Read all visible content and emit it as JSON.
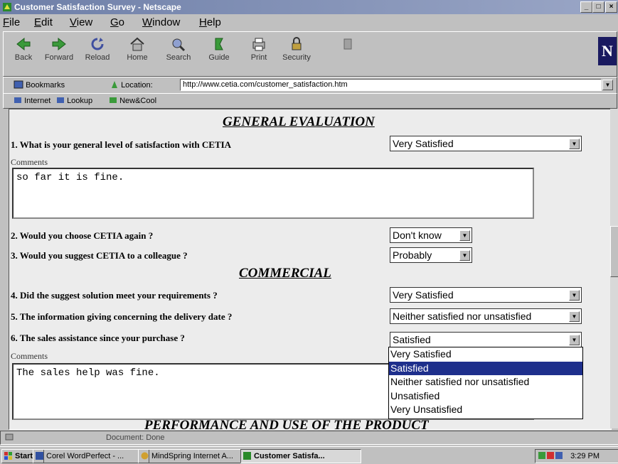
{
  "window": {
    "title": "Customer Satisfaction Survey - Netscape",
    "controls": [
      "_",
      "□",
      "×"
    ]
  },
  "menu": [
    "File",
    "Edit",
    "View",
    "Go",
    "Window",
    "Help"
  ],
  "toolbar": {
    "buttons": [
      "Back",
      "Forward",
      "Reload",
      "Home",
      "Search",
      "Guide",
      "Print",
      "Security"
    ],
    "logo": "N"
  },
  "location": {
    "bookmarks_label": "Bookmarks",
    "location_label": "Location:",
    "url": "http://www.cetia.com/customer_satisfaction.htm"
  },
  "personal_toolbar": [
    "Internet",
    "Lookup",
    "New&Cool"
  ],
  "survey": {
    "sections": {
      "general": "GENERAL EVALUATION",
      "commercial": "COMMERCIAL",
      "performance": "PERFORMANCE AND USE OF THE PRODUCT"
    },
    "comments_label": "Comments",
    "questions": [
      {
        "text": "1. What is your general level of satisfaction with CETIA",
        "answer": "Very Satisfied"
      },
      {
        "text": "2. Would you choose CETIA again ?",
        "answer": "Don't know"
      },
      {
        "text": "3. Would you suggest CETIA to a colleague ?",
        "answer": "Probably"
      },
      {
        "text": "4. Did the suggest solution meet your requirements ?",
        "answer": "Very Satisfied"
      },
      {
        "text": "5. The information giving concerning the delivery date ?",
        "answer": "Neither satisfied nor unsatisfied"
      },
      {
        "text": "6. The sales assistance since your purchase ?",
        "answer": "Satisfied"
      }
    ],
    "comment1": "so far it is fine.",
    "comment2": "The sales help was fine.",
    "dropdown_options": [
      "Very Satisfied",
      "Satisfied",
      "Neither satisfied nor unsatisfied",
      "Unsatisfied",
      "Very Unsatisfied"
    ],
    "dropdown_highlight": "Satisfied"
  },
  "status": {
    "text": "Document: Done"
  },
  "taskbar": {
    "start": "Start",
    "tasks": [
      "Corel WordPerfect - ...",
      "MindSpring Internet A...",
      "Customer Satisfa..."
    ],
    "time": "3:29 PM"
  },
  "colors": {
    "selection": "#1e2f8c",
    "titlebar": "#6e7fa8"
  }
}
